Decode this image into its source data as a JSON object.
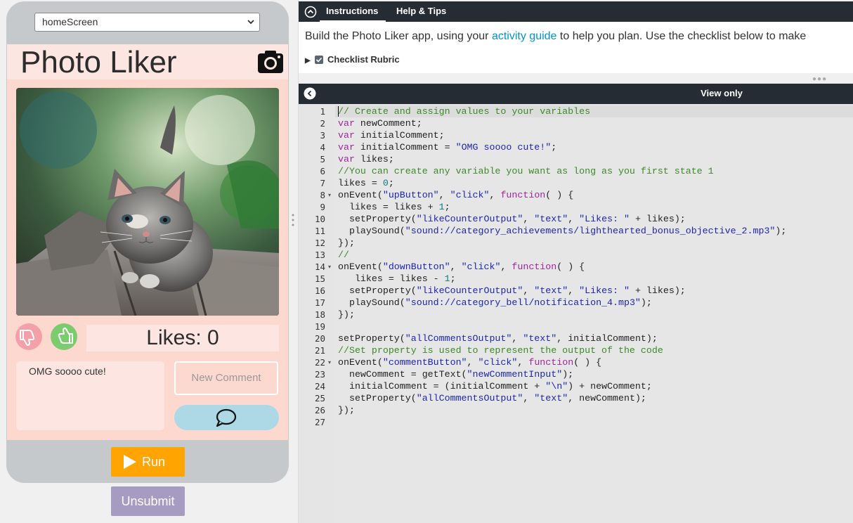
{
  "phone": {
    "screen_select": "homeScreen",
    "app_title": "Photo Liker",
    "likes_text": "Likes: 0",
    "comments_text": "OMG soooo cute!",
    "new_comment_placeholder": "New Comment"
  },
  "buttons": {
    "run": "Run",
    "unsubmit": "Unsubmit"
  },
  "instructions": {
    "tabs": [
      "Instructions",
      "Help & Tips"
    ],
    "text_before": "Build the Photo Liker app, using your ",
    "link": "activity guide",
    "text_after": " to help you plan. Use the checklist below to make",
    "rubric": "Checklist Rubric"
  },
  "code_header": "View only",
  "code_lines": [
    [
      [
        "c",
        "// Create and assign values to your variables"
      ]
    ],
    [
      [
        "k",
        "var"
      ],
      [
        "t",
        " newComment;"
      ]
    ],
    [
      [
        "k",
        "var"
      ],
      [
        "t",
        " initialComment;"
      ]
    ],
    [
      [
        "k",
        "var"
      ],
      [
        "t",
        " initialComment = "
      ],
      [
        "s",
        "\"OMG soooo cute!\""
      ],
      [
        "t",
        ";"
      ]
    ],
    [
      [
        "k",
        "var"
      ],
      [
        "t",
        " likes;"
      ]
    ],
    [
      [
        "c",
        "//You can create any variable you want as long as you first state 1"
      ]
    ],
    [
      [
        "t",
        "likes = "
      ],
      [
        "n",
        "0"
      ],
      [
        "t",
        ";"
      ]
    ],
    [
      [
        "t",
        "onEvent("
      ],
      [
        "s",
        "\"upButton\""
      ],
      [
        "t",
        ", "
      ],
      [
        "s",
        "\"click\""
      ],
      [
        "t",
        ", "
      ],
      [
        "k",
        "function"
      ],
      [
        "t",
        "( ) {"
      ]
    ],
    [
      [
        "t",
        "  likes = likes + "
      ],
      [
        "n",
        "1"
      ],
      [
        "t",
        ";"
      ]
    ],
    [
      [
        "t",
        "  setProperty("
      ],
      [
        "s",
        "\"likeCounterOutput\""
      ],
      [
        "t",
        ", "
      ],
      [
        "s",
        "\"text\""
      ],
      [
        "t",
        ", "
      ],
      [
        "s",
        "\"Likes: \""
      ],
      [
        "t",
        " + likes);"
      ]
    ],
    [
      [
        "t",
        "  playSound("
      ],
      [
        "s",
        "\"sound://category_achievements/lighthearted_bonus_objective_2.mp3\""
      ],
      [
        "t",
        ");"
      ]
    ],
    [
      [
        "t",
        "});"
      ]
    ],
    [
      [
        "c",
        "//"
      ]
    ],
    [
      [
        "t",
        "onEvent("
      ],
      [
        "s",
        "\"downButton\""
      ],
      [
        "t",
        ", "
      ],
      [
        "s",
        "\"click\""
      ],
      [
        "t",
        ", "
      ],
      [
        "k",
        "function"
      ],
      [
        "t",
        "( ) {"
      ]
    ],
    [
      [
        "t",
        "   likes = likes - "
      ],
      [
        "n",
        "1"
      ],
      [
        "t",
        ";"
      ]
    ],
    [
      [
        "t",
        "  setProperty("
      ],
      [
        "s",
        "\"likeCounterOutput\""
      ],
      [
        "t",
        ", "
      ],
      [
        "s",
        "\"text\""
      ],
      [
        "t",
        ", "
      ],
      [
        "s",
        "\"Likes: \""
      ],
      [
        "t",
        " + likes);"
      ]
    ],
    [
      [
        "t",
        "  playSound("
      ],
      [
        "s",
        "\"sound://category_bell/notification_4.mp3\""
      ],
      [
        "t",
        ");"
      ]
    ],
    [
      [
        "t",
        "});"
      ]
    ],
    [
      [
        "t",
        ""
      ]
    ],
    [
      [
        "t",
        "setProperty("
      ],
      [
        "s",
        "\"allCommentsOutput\""
      ],
      [
        "t",
        ", "
      ],
      [
        "s",
        "\"text\""
      ],
      [
        "t",
        ", initialComment);"
      ]
    ],
    [
      [
        "c",
        "//Set property is used to represent the output of the code"
      ]
    ],
    [
      [
        "t",
        "onEvent("
      ],
      [
        "s",
        "\"commentButton\""
      ],
      [
        "t",
        ", "
      ],
      [
        "s",
        "\"click\""
      ],
      [
        "t",
        ", "
      ],
      [
        "k",
        "function"
      ],
      [
        "t",
        "( ) {"
      ]
    ],
    [
      [
        "t",
        "  newComment = getText("
      ],
      [
        "s",
        "\"newCommentInput\""
      ],
      [
        "t",
        ");"
      ]
    ],
    [
      [
        "t",
        "  initialComment = (initialComment + "
      ],
      [
        "s",
        "\"\\n\""
      ],
      [
        "t",
        ") + newComment;"
      ]
    ],
    [
      [
        "t",
        "  setProperty("
      ],
      [
        "s",
        "\"allCommentsOutput\""
      ],
      [
        "t",
        ", "
      ],
      [
        "s",
        "\"text\""
      ],
      [
        "t",
        ", newComment);"
      ]
    ],
    [
      [
        "t",
        "});"
      ]
    ],
    [
      [
        "t",
        ""
      ]
    ]
  ],
  "fold_lines": [
    8,
    14,
    22
  ],
  "colors": {
    "run": "#ffa400",
    "unsubmit": "#a69bc1",
    "header_bar": "#262c33",
    "link": "#0094ca",
    "keyword": "#a0249c",
    "string": "#1c24b5",
    "comment": "#3a8a28"
  },
  "icons": [
    "camera-icon",
    "thumbs-down-icon",
    "thumbs-up-icon",
    "chat-bubble-icon",
    "play-icon",
    "collapse-icon",
    "back-icon"
  ]
}
